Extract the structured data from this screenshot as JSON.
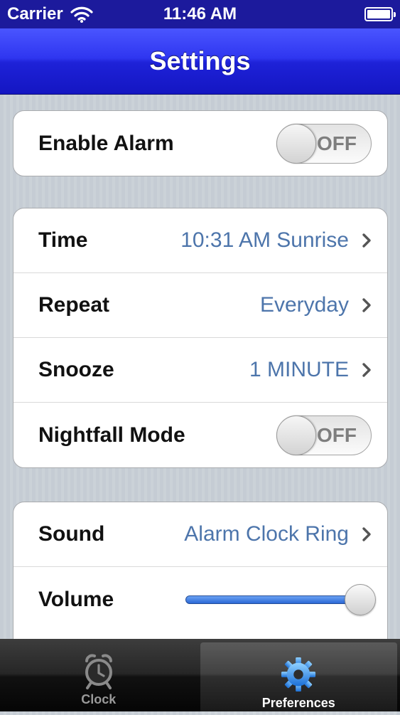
{
  "status_bar": {
    "carrier": "Carrier",
    "time": "11:46 AM"
  },
  "nav_bar": {
    "title": "Settings"
  },
  "alarm_group": {
    "enable_alarm": {
      "label": "Enable Alarm",
      "toggle": "OFF"
    }
  },
  "schedule_group": {
    "time": {
      "label": "Time",
      "value": "10:31 AM Sunrise"
    },
    "repeat": {
      "label": "Repeat",
      "value": "Everyday"
    },
    "snooze": {
      "label": "Snooze",
      "value": "1 MINUTE"
    },
    "nightfall": {
      "label": "Nightfall Mode",
      "toggle": "OFF"
    }
  },
  "sound_group": {
    "sound": {
      "label": "Sound",
      "value": "Alarm Clock Ring"
    },
    "volume": {
      "label": "Volume",
      "level": 1.0
    }
  },
  "tab_bar": {
    "tabs": [
      {
        "label": "Clock",
        "icon": "alarm-clock-icon",
        "active": false
      },
      {
        "label": "Preferences",
        "icon": "gear-icon",
        "active": true
      }
    ]
  },
  "colors": {
    "nav_blue": "#2f36f0",
    "status_blue": "#1c1a9c",
    "value_blue": "#4d75ab",
    "slider_blue": "#2b68d6"
  }
}
